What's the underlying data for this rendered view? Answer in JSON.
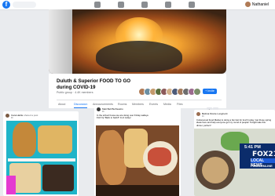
{
  "topbar": {
    "user_name": "Nathaniel"
  },
  "group": {
    "title": "Duluth & Superior FOOD TO GO during COVID-19",
    "subtitle": "Public group · 4.4K members",
    "join_label": "+ Invite"
  },
  "tabs": [
    {
      "label": "About"
    },
    {
      "label": "Discussion"
    },
    {
      "label": "Announcements"
    },
    {
      "label": "Rooms"
    },
    {
      "label": "Members"
    },
    {
      "label": "Events"
    },
    {
      "label": "Media"
    },
    {
      "label": "Files"
    }
  ],
  "posts": {
    "left": {
      "name": "Cara Hartle",
      "suffix": "shared a post",
      "time": "4h"
    },
    "mid": {
      "name": "Matt Bell Burfisastro",
      "time": "4h",
      "text": "In the school house we are doing over Friday walleye Fish fry! Back to back!!! 11-4 today!"
    },
    "right": {
      "name": "Bettina Nicole Longinotti",
      "time": "1h",
      "text": "Cottonwood Food Market is doing a fan fest for lunch today. Get those spring ideas here and help everyone get my round of people! Tonight take this dinner, perfect!"
    }
  },
  "news_badge": {
    "time": "5:41 PM",
    "brand": "FOX21",
    "line1": "LOCAL NEWS",
    "line2": "FOX21ONLINE"
  },
  "colors": {
    "accent": "#1877f2",
    "background": "#e9ebee",
    "news_blue": "#0b2c6b"
  }
}
